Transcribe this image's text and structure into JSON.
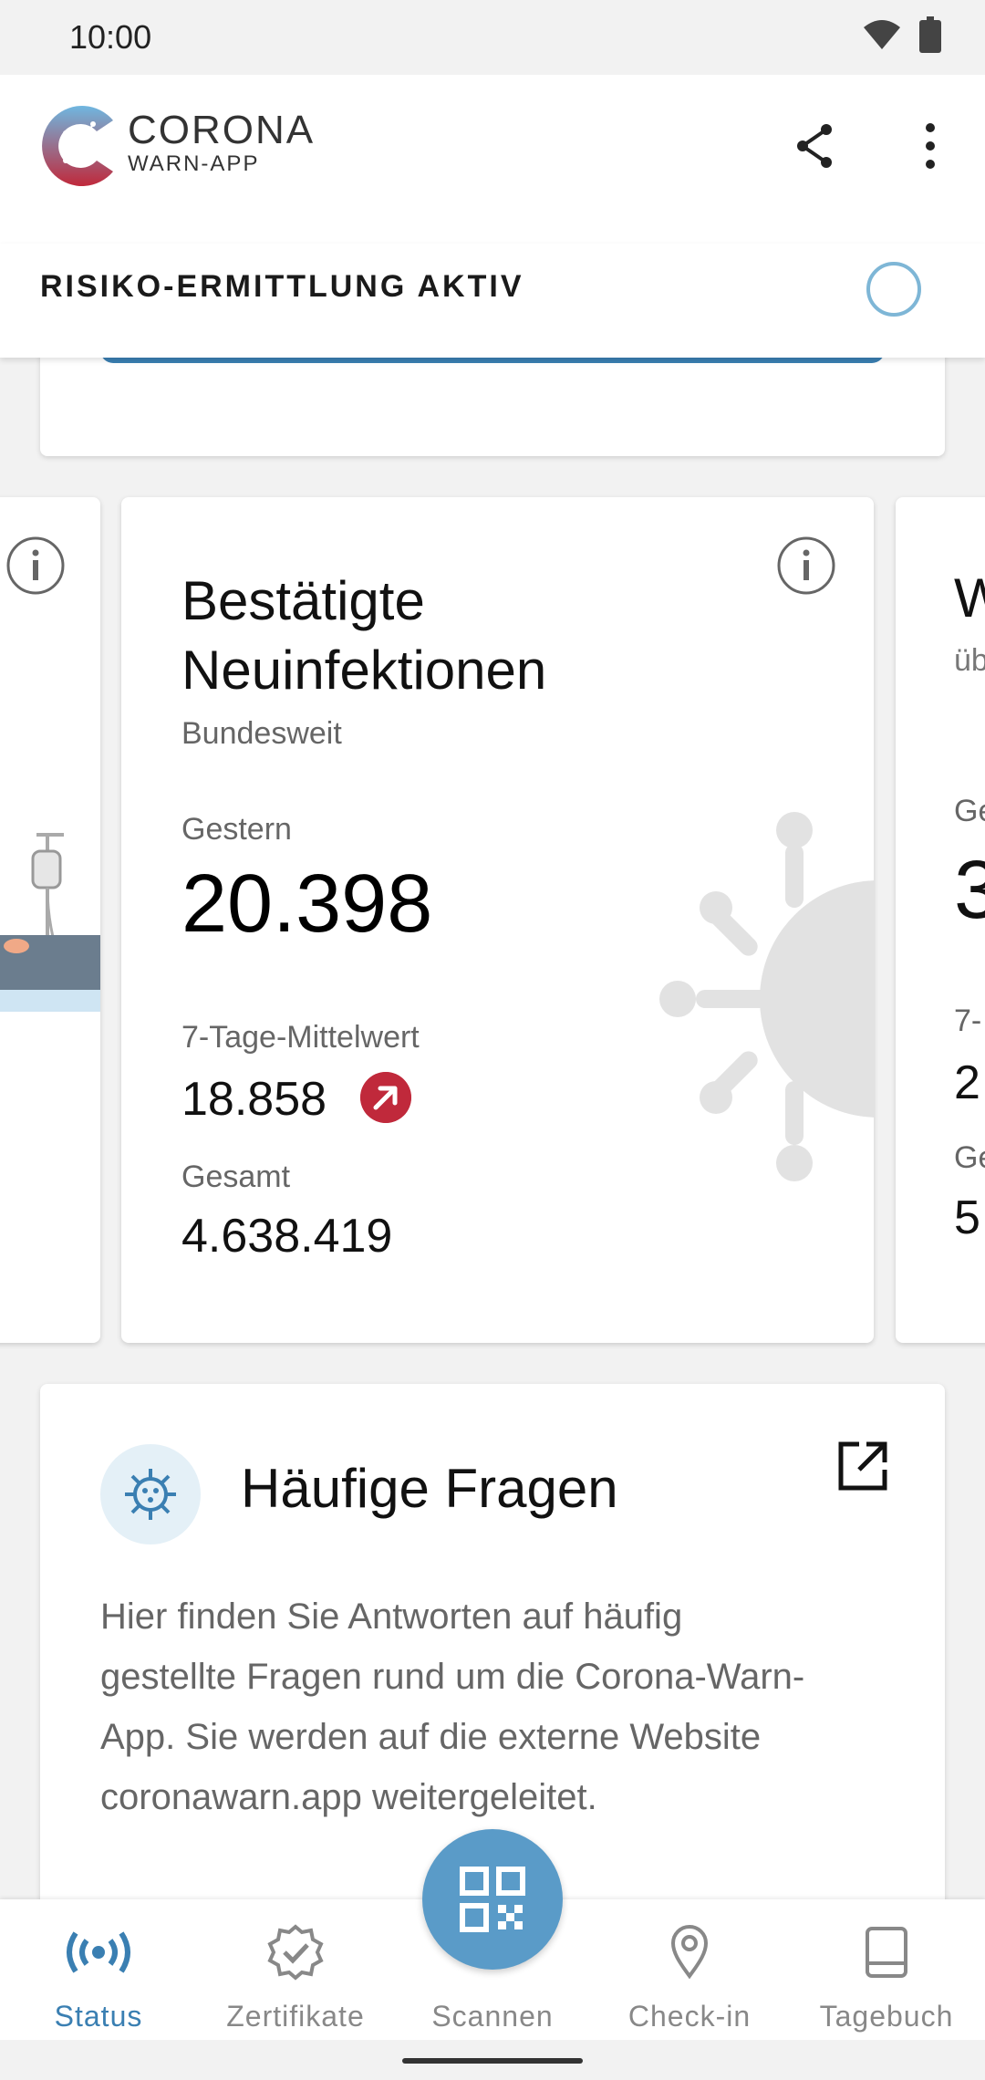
{
  "status_bar": {
    "time": "10:00"
  },
  "app_bar": {
    "logo_line1": "CORONA",
    "logo_line2": "WARN-APP"
  },
  "risk": {
    "label": "RISIKO-ERMITTLUNG AKTIV"
  },
  "main_card": {
    "title_line1": "Bestätigte",
    "title_line2": "Neuinfektionen",
    "subtitle": "Bundesweit",
    "yesterday_label": "Gestern",
    "yesterday_value": "20.398",
    "avg_label": "7-Tage-Mittelwert",
    "avg_value": "18.858",
    "avg_trend": "up",
    "total_label": "Gesamt",
    "total_value": "4.638.419"
  },
  "right_card_partial": {
    "title": "W",
    "subtitle": "üb",
    "l1": "Ge",
    "big": "3",
    "l2": "7-",
    "v2": "2",
    "l3": "Ge",
    "v3": "5"
  },
  "faq": {
    "title": "Häufige Fragen",
    "text": "Hier finden Sie Antworten auf häufig gestellte Fragen rund um die Corona-Warn-App. Sie werden auf die externe Website coronawarn.app weitergeleitet."
  },
  "nav": {
    "items": [
      {
        "label": "Status",
        "icon": "broadcast-icon",
        "active": true
      },
      {
        "label": "Zertifikate",
        "icon": "certificate-icon",
        "active": false
      },
      {
        "label": "Scannen",
        "icon": "qr-code-icon",
        "active": false
      },
      {
        "label": "Check-in",
        "icon": "location-pin-icon",
        "active": false
      },
      {
        "label": "Tagebuch",
        "icon": "book-icon",
        "active": false
      }
    ]
  },
  "colors": {
    "accent": "#3a7fb2",
    "trend_up": "#c0293b",
    "fab": "#5a9bc8"
  }
}
